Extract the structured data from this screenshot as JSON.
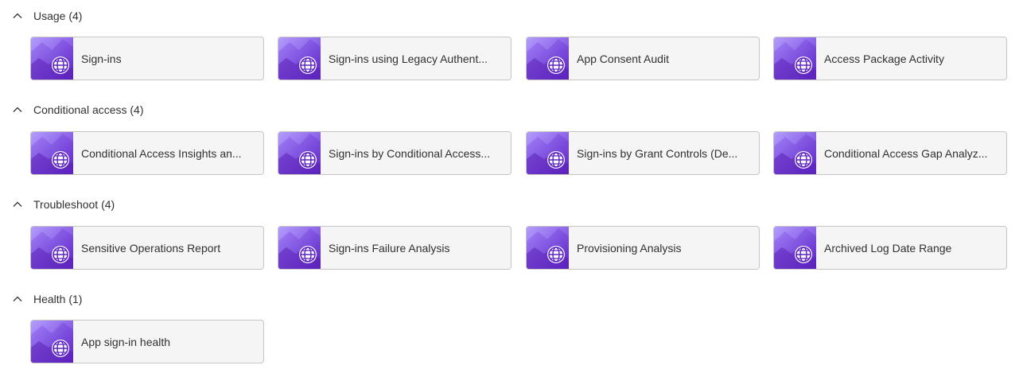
{
  "colors": {
    "accent_light": "#a78bfa",
    "accent_dark": "#6d28d9",
    "tile_bg": "#f5f5f5",
    "tile_border": "#c8c6c4"
  },
  "icons": {
    "group_toggle": "chevron-up-icon",
    "tile": "workbook-globe-icon"
  },
  "groups": [
    {
      "title": "Usage (4)",
      "tiles": [
        "Sign-ins",
        "Sign-ins using Legacy Authent...",
        "App Consent Audit",
        "Access Package Activity"
      ]
    },
    {
      "title": "Conditional access (4)",
      "tiles": [
        "Conditional Access Insights an...",
        "Sign-ins by Conditional Access...",
        "Sign-ins by Grant Controls (De...",
        "Conditional Access Gap Analyz..."
      ]
    },
    {
      "title": "Troubleshoot (4)",
      "tiles": [
        "Sensitive Operations Report",
        "Sign-ins Failure Analysis",
        "Provisioning Analysis",
        "Archived Log Date Range"
      ]
    },
    {
      "title": "Health (1)",
      "tiles": [
        "App sign-in health"
      ]
    }
  ]
}
